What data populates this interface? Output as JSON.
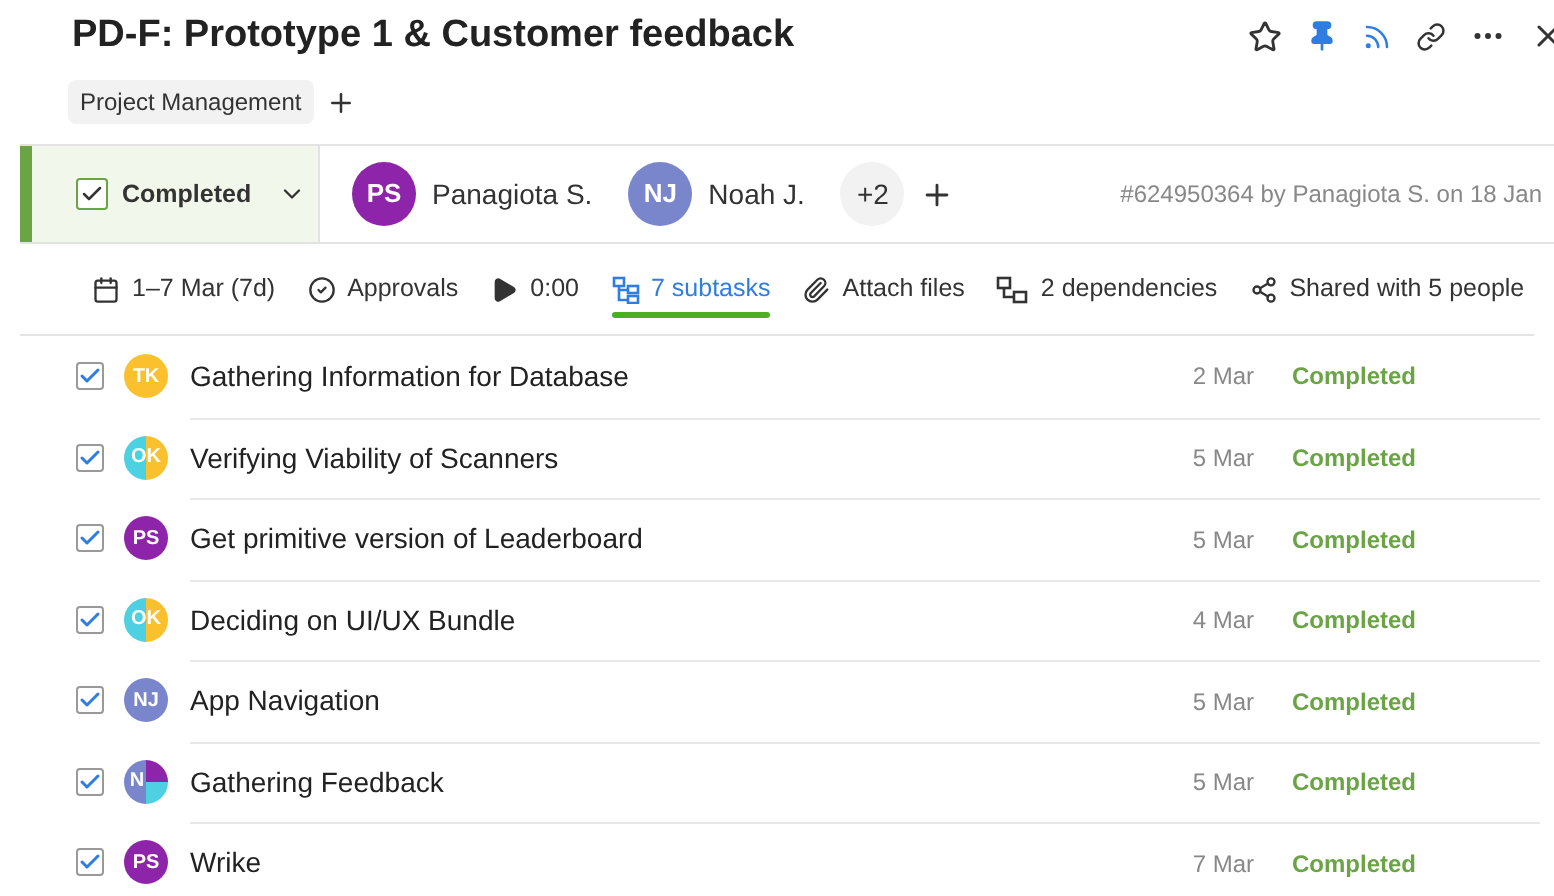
{
  "title": "PD-F: Prototype 1 & Customer feedback",
  "tags": [
    "Project Management"
  ],
  "status": {
    "label": "Completed",
    "checked": true
  },
  "assignees": [
    {
      "initials": "PS",
      "name": "Panagiota S.",
      "color": "#8e24aa"
    },
    {
      "initials": "NJ",
      "name": "Noah J.",
      "color": "#7986cb"
    }
  ],
  "more_assignees": "+2",
  "meta": "#624950364 by Panagiota S. on 18 Jan",
  "toolbar": [
    {
      "kind": "dates",
      "label": "1–7 Mar (7d)",
      "selected": false
    },
    {
      "kind": "approvals",
      "label": "Approvals",
      "selected": false
    },
    {
      "kind": "timer",
      "label": "0:00",
      "selected": false
    },
    {
      "kind": "subtasks",
      "label": "7 subtasks",
      "selected": true
    },
    {
      "kind": "attach",
      "label": "Attach files",
      "selected": false
    },
    {
      "kind": "dependencies",
      "label": "2 dependencies",
      "selected": false
    },
    {
      "kind": "share",
      "label": "Shared with 5 people",
      "selected": false
    }
  ],
  "subtasks": [
    {
      "checked": true,
      "avatar": {
        "kind": "single",
        "initials": "TK",
        "segments": [
          {
            "color": "#fbc02d"
          }
        ]
      },
      "title": "Gathering Information for Database",
      "date": "2 Mar",
      "status": "Completed"
    },
    {
      "checked": true,
      "avatar": {
        "kind": "split",
        "initials": "OK",
        "segments": [
          {
            "color": "#4dd0e1"
          },
          {
            "color": "#fbc02d"
          }
        ]
      },
      "title": "Verifying Viability of Scanners",
      "date": "5 Mar",
      "status": "Completed"
    },
    {
      "checked": true,
      "avatar": {
        "kind": "single",
        "initials": "PS",
        "segments": [
          {
            "color": "#8e24aa"
          }
        ]
      },
      "title": "Get primitive version of Leaderboard",
      "date": "5 Mar",
      "status": "Completed"
    },
    {
      "checked": true,
      "avatar": {
        "kind": "split",
        "initials": "OK",
        "segments": [
          {
            "color": "#4dd0e1"
          },
          {
            "color": "#fbc02d"
          }
        ]
      },
      "title": "Deciding on UI/UX Bundle",
      "date": "4 Mar",
      "status": "Completed"
    },
    {
      "checked": true,
      "avatar": {
        "kind": "single",
        "initials": "NJ",
        "segments": [
          {
            "color": "#7986cb"
          }
        ]
      },
      "title": "App Navigation",
      "date": "5 Mar",
      "status": "Completed"
    },
    {
      "checked": true,
      "avatar": {
        "kind": "group",
        "initials": "N",
        "segments": [
          {
            "color": "#7986cb"
          },
          {
            "color": "#8e24aa"
          },
          {
            "color": "#4dd0e1"
          }
        ]
      },
      "title": "Gathering Feedback",
      "date": "5 Mar",
      "status": "Completed"
    },
    {
      "checked": true,
      "avatar": {
        "kind": "single",
        "initials": "PS",
        "segments": [
          {
            "color": "#8e24aa"
          }
        ]
      },
      "title": "Wrike",
      "date": "7 Mar",
      "status": "Completed"
    }
  ]
}
